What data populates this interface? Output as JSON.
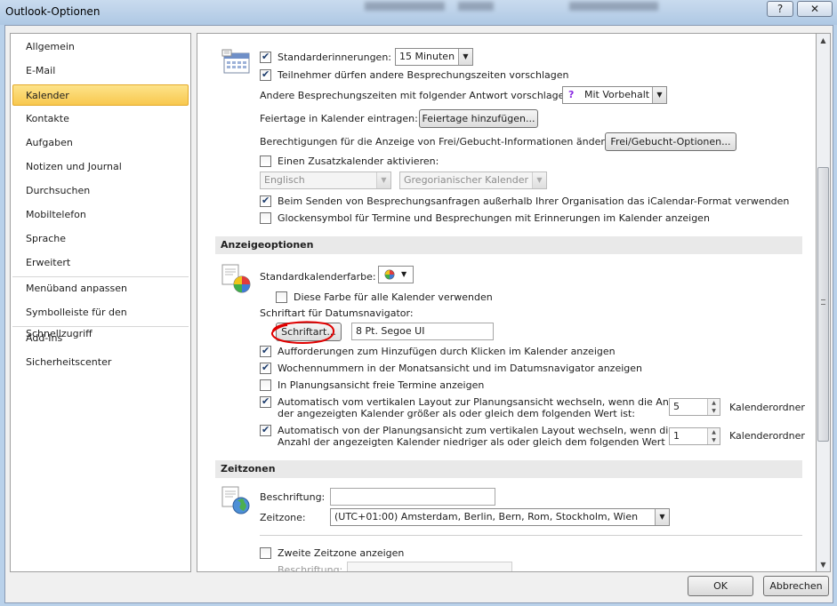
{
  "window": {
    "title": "Outlook-Optionen",
    "help_glyph": "?",
    "close_glyph": "✕"
  },
  "nav": {
    "items": [
      {
        "label": "Allgemein"
      },
      {
        "label": "E-Mail"
      },
      {
        "label": "Kalender",
        "selected": true
      },
      {
        "label": "Kontakte"
      },
      {
        "label": "Aufgaben"
      },
      {
        "label": "Notizen und Journal"
      },
      {
        "label": "Durchsuchen"
      },
      {
        "label": "Mobiltelefon"
      },
      {
        "label": "Sprache"
      },
      {
        "label": "Erweitert"
      },
      {
        "label": "Menüband anpassen"
      },
      {
        "label": "Symbolleiste für den Schnellzugriff"
      },
      {
        "label": "Add-Ins"
      },
      {
        "label": "Sicherheitscenter"
      }
    ]
  },
  "calendar": {
    "default_reminders_label": "Standarderinnerungen:",
    "default_reminders_checked": true,
    "default_reminders_value": "15 Minuten",
    "attendees_propose_label": "Teilnehmer dürfen andere Besprechungszeiten vorschlagen",
    "attendees_propose_checked": true,
    "propose_response_label": "Andere Besprechungszeiten mit folgender Antwort vorschlagen:",
    "propose_response_value": "Mit Vorbehalt",
    "holidays_label": "Feiertage in Kalender eintragen:",
    "holidays_button": "Feiertage hinzufügen...",
    "freebusy_label": "Berechtigungen für die Anzeige von Frei/Gebucht-Informationen ändern:",
    "freebusy_button": "Frei/Gebucht-Optionen...",
    "alt_calendar_label": "Einen Zusatzkalender aktivieren:",
    "alt_calendar_checked": false,
    "alt_calendar_language": "Englisch",
    "alt_calendar_type": "Gregorianischer Kalender",
    "icalendar_label": "Beim Senden von Besprechungsanfragen außerhalb Ihrer Organisation das iCalendar-Format verwenden",
    "icalendar_checked": true,
    "bell_label": "Glockensymbol für Termine und Besprechungen mit Erinnerungen im Kalender anzeigen",
    "bell_checked": false
  },
  "display": {
    "header": "Anzeigeoptionen",
    "default_color_label": "Standardkalenderfarbe:",
    "use_color_all_label": "Diese Farbe für alle Kalender verwenden",
    "use_color_all_checked": false,
    "date_nav_font_label": "Schriftart für Datumsnavigator:",
    "font_button": "Schriftart...",
    "font_value": "8 Pt. Segoe UI",
    "click_to_add_label": "Aufforderungen zum Hinzufügen durch Klicken im Kalender anzeigen",
    "click_to_add_checked": true,
    "week_numbers_label": "Wochennummern in der Monatsansicht und im Datumsnavigator anzeigen",
    "week_numbers_checked": true,
    "free_appts_label": "In Planungsansicht freie Termine anzeigen",
    "free_appts_checked": false,
    "auto_switch_vertical_line1": "Automatisch vom vertikalen Layout zur Planungsansicht wechseln, wenn die Anzahl",
    "auto_switch_vertical_line2": "der angezeigten Kalender größer als oder gleich dem folgenden Wert ist:",
    "auto_switch_vertical_checked": true,
    "auto_switch_vertical_value": "5",
    "auto_switch_vertical_unit": "Kalenderordner",
    "auto_switch_schedule_line1": "Automatisch von der Planungsansicht zum vertikalen Layout wechseln, wenn die",
    "auto_switch_schedule_line2": "Anzahl der angezeigten Kalender niedriger als oder gleich dem folgenden Wert ist:",
    "auto_switch_schedule_checked": true,
    "auto_switch_schedule_value": "1",
    "auto_switch_schedule_unit": "Kalenderordner"
  },
  "timezones": {
    "header": "Zeitzonen",
    "label_label": "Beschriftung:",
    "label_value": "",
    "zone_label": "Zeitzone:",
    "zone_value": "(UTC+01:00) Amsterdam, Berlin, Bern, Rom, Stockholm, Wien",
    "second_zone_label": "Zweite Zeitzone anzeigen",
    "second_zone_checked": false,
    "second_label_label": "Beschriftung:"
  },
  "footer": {
    "ok": "OK",
    "cancel": "Abbrechen"
  },
  "colors": {
    "selected_nav": "#f8c84e",
    "annotation_circle": "#e00000"
  },
  "icons": [
    "calendar-options-icon",
    "display-options-icon",
    "timezone-globe-icon",
    "color-swatch-icon",
    "help-icon",
    "close-icon"
  ]
}
